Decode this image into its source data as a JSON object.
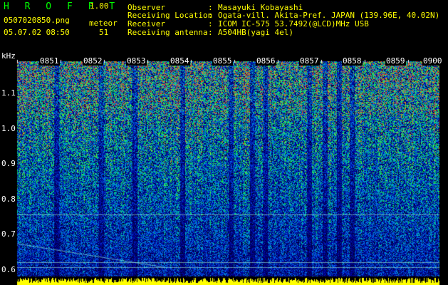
{
  "header": {
    "app_name": "H R O F F T",
    "version": "1.00",
    "filename": "0507020850.png",
    "datetime": "05.07.02 08:50",
    "mode_label": "meteor",
    "count": "51"
  },
  "info": [
    {
      "label": "Observer",
      "value": "Masayuki Kobayashi"
    },
    {
      "label": "Receiving Location",
      "value": "Ogata-vill. Akita-Pref. JAPAN (139.96E, 40.02N)"
    },
    {
      "label": "Receiver",
      "value": "ICOM IC-575 53.7492(@LCD)MHz USB"
    },
    {
      "label": "Receiving antenna",
      "value": "A504HB(yagi 4el)"
    }
  ],
  "y_axis": {
    "unit": "kHz",
    "ticks": [
      "1.1",
      "1.0",
      "0.9",
      "0.8",
      "0.7",
      "0.6"
    ]
  },
  "x_axis": {
    "ticks": [
      "0851",
      "0852",
      "0853",
      "0854",
      "0855",
      "0856",
      "0857",
      "0858",
      "0859",
      "0900"
    ]
  },
  "colors": {
    "text": "#ffff00",
    "logo": "#00ff00",
    "axis": "#ffffff"
  }
}
